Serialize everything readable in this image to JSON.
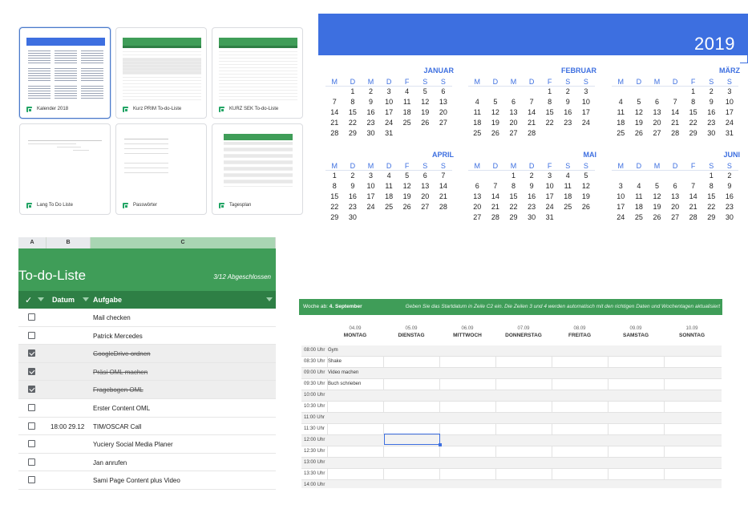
{
  "templates": [
    {
      "label": "Kalender 2018"
    },
    {
      "label": "Kurz PRIM To-do-Liste"
    },
    {
      "label": "KURZ SEK To-do-Liste"
    },
    {
      "label": "Lang To Do Liste"
    },
    {
      "label": "Passwörter"
    },
    {
      "label": "Tagesplan"
    }
  ],
  "calendar": {
    "year": "2019",
    "weekday_headers": [
      "M",
      "D",
      "M",
      "D",
      "F",
      "S",
      "S"
    ],
    "months": [
      {
        "name": "JANUAR",
        "offset": 1,
        "days": 31
      },
      {
        "name": "FEBRUAR",
        "offset": 4,
        "days": 28
      },
      {
        "name": "MÄRZ",
        "offset": 4,
        "days": 31
      },
      {
        "name": "APRIL",
        "offset": 0,
        "days": 30
      },
      {
        "name": "MAI",
        "offset": 2,
        "days": 31
      },
      {
        "name": "JUNI",
        "offset": 5,
        "days": 30
      }
    ]
  },
  "todo": {
    "columns": [
      "A",
      "B",
      "C"
    ],
    "title": "To-do-Liste",
    "count": "3/12 Abgeschlossen",
    "header_check": "✓",
    "header_date": "Datum",
    "header_task": "Aufgabe",
    "items": [
      {
        "checked": false,
        "date": "",
        "task": "Mail checken"
      },
      {
        "checked": false,
        "date": "",
        "task": "Patrick Mercedes"
      },
      {
        "checked": true,
        "date": "",
        "task": "GoogleDrive ordnen"
      },
      {
        "checked": true,
        "date": "",
        "task": "Präsi OML machen"
      },
      {
        "checked": true,
        "date": "",
        "task": "Fragebogen OML"
      },
      {
        "checked": false,
        "date": "",
        "task": "Erster Content OML"
      },
      {
        "checked": false,
        "date": "18:00 29.12",
        "task": "TIM/OSCAR Call"
      },
      {
        "checked": false,
        "date": "",
        "task": "Yuciery Social Media Planer"
      },
      {
        "checked": false,
        "date": "",
        "task": "Jan anrufen"
      },
      {
        "checked": false,
        "date": "",
        "task": "Sami Page Content plus Video"
      }
    ]
  },
  "week": {
    "label": "Woche ab:",
    "start": "4. September",
    "note": "Geben Sie das Startdatum in Zeile C2 ein. Die Zeilen 3 und 4 werden automatisch mit den richtigen Daten und Wochentagen aktualisiert",
    "days": [
      {
        "date": "04.09",
        "name": "MONTAG"
      },
      {
        "date": "05.09",
        "name": "DIENSTAG"
      },
      {
        "date": "06.09",
        "name": "MITTWOCH"
      },
      {
        "date": "07.09",
        "name": "DONNERSTAG"
      },
      {
        "date": "08.09",
        "name": "FREITAG"
      },
      {
        "date": "09.09",
        "name": "SAMSTAG"
      },
      {
        "date": "10.09",
        "name": "SONNTAG"
      }
    ],
    "slots": [
      {
        "time": "08:00 Uhr",
        "event": "Gym"
      },
      {
        "time": "08:30 Uhr",
        "event": "Shake"
      },
      {
        "time": "09:00 Uhr",
        "event": "Video machen"
      },
      {
        "time": "09:30 Uhr",
        "event": "Buch schrieben"
      },
      {
        "time": "10:00 Uhr",
        "event": ""
      },
      {
        "time": "10:30 Uhr",
        "event": ""
      },
      {
        "time": "11:00 Uhr",
        "event": ""
      },
      {
        "time": "11:30 Uhr",
        "event": ""
      },
      {
        "time": "12:00 Uhr",
        "event": ""
      },
      {
        "time": "12:30 Uhr",
        "event": ""
      },
      {
        "time": "13:00 Uhr",
        "event": ""
      },
      {
        "time": "13:30 Uhr",
        "event": ""
      },
      {
        "time": "14:00 Uhr",
        "event": ""
      }
    ]
  },
  "colors": {
    "calendar_blue": "#3d6fe0",
    "sheet_green": "#3f9d58",
    "dark_green": "#2e7f45"
  }
}
